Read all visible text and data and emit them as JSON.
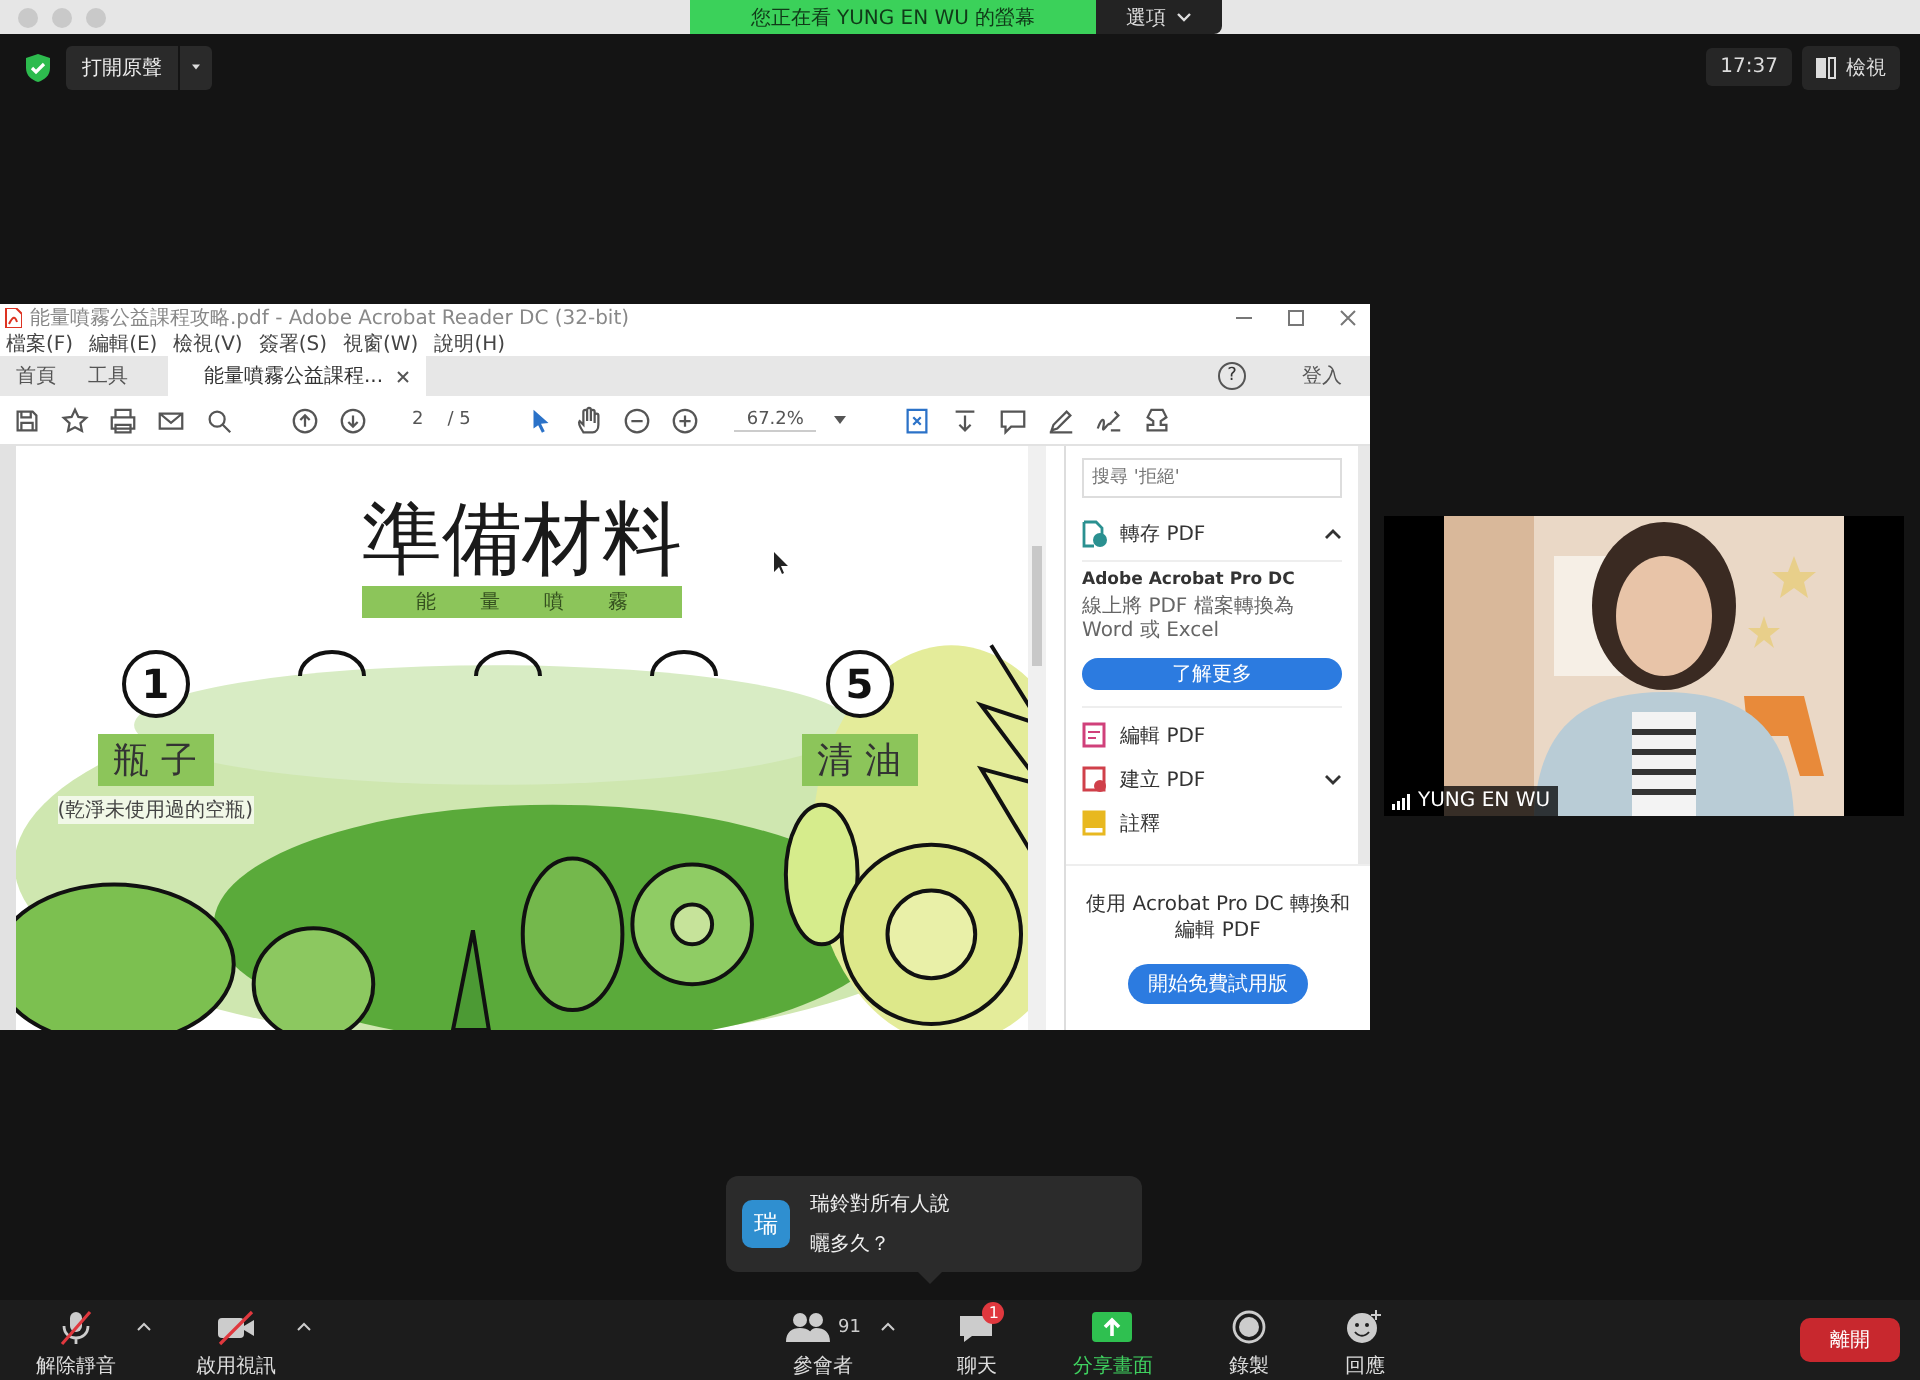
{
  "top_bar": {
    "share_banner": "您正在看 YUNG EN WU 的螢幕",
    "options": "選項"
  },
  "header": {
    "audio_button": "打開原聲",
    "clock": "17:37",
    "view_button": "檢視"
  },
  "acrobat": {
    "title": "能量噴霧公益課程攻略.pdf - Adobe Acrobat Reader DC (32-bit)",
    "menu": [
      "檔案(F)",
      "編輯(E)",
      "檢視(V)",
      "簽署(S)",
      "視窗(W)",
      "說明(H)"
    ],
    "tabs": [
      {
        "label": "首頁",
        "selected": false,
        "closable": false
      },
      {
        "label": "工具",
        "selected": false,
        "closable": false
      },
      {
        "label": "能量噴霧公益課程...",
        "selected": true,
        "closable": true
      }
    ],
    "help": "?",
    "sign_in": "登入",
    "page": "2",
    "page_total": "/ 5",
    "zoom": "67.2%",
    "slide": {
      "title": "準備材料",
      "subtitle": "能量噴霧",
      "items": [
        {
          "kind": "numbered",
          "number": "1",
          "label": "瓶子",
          "note": "(乾淨未使用過的空瓶)"
        },
        {
          "kind": "hidden"
        },
        {
          "kind": "hidden"
        },
        {
          "kind": "hidden"
        },
        {
          "kind": "numbered",
          "number": "5",
          "label": "清油"
        }
      ]
    },
    "panel": {
      "search_placeholder": "搜尋 '拒絕'",
      "convert": {
        "label": "轉存 PDF",
        "expanded": true,
        "product": "Adobe Acrobat Pro DC",
        "description": "線上將 PDF 檔案轉換為 Word 或 Excel",
        "button": "了解更多"
      },
      "tools": [
        {
          "kind": "edit",
          "label": "編輯 PDF",
          "chevron": false
        },
        {
          "kind": "create",
          "label": "建立 PDF",
          "chevron": true
        },
        {
          "kind": "comment",
          "label": "註釋",
          "chevron": false
        }
      ],
      "promo": "使用 Acrobat Pro DC 轉換和編輯 PDF",
      "trial_button": "開始免費試用版"
    }
  },
  "video": {
    "name": "YUNG EN WU"
  },
  "chat_popup": {
    "avatar": "瑞",
    "sender": "瑞鈴對所有人說",
    "message": "曬多久？"
  },
  "toolbar": {
    "audio": {
      "label": "解除靜音",
      "muted": true
    },
    "video": {
      "label": "啟用視訊",
      "off": true
    },
    "items": [
      {
        "kind": "participants",
        "label": "參會者",
        "count": "91"
      },
      {
        "kind": "chat",
        "label": "聊天",
        "badge": "1"
      },
      {
        "kind": "share",
        "label": "分享畫面"
      },
      {
        "kind": "record",
        "label": "錄製"
      },
      {
        "kind": "reactions",
        "label": "回應"
      }
    ],
    "leave": "離開"
  }
}
